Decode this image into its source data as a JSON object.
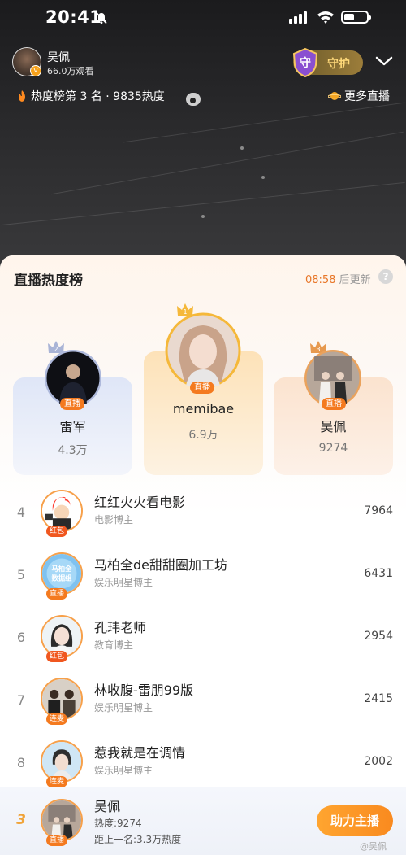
{
  "status_bar": {
    "time": "20:41"
  },
  "host": {
    "name": "吴佩",
    "viewers": "66.0万观看",
    "guard_label": "守护",
    "guard_icon_text": "守"
  },
  "heat": {
    "text": "热度榜第 3 名 · 9835热度",
    "more_live": "更多直播"
  },
  "panel": {
    "title": "直播热度榜",
    "update_time": "08:58",
    "update_suffix": " 后更新",
    "help": "?"
  },
  "top3": [
    {
      "rank": "1",
      "name": "memibae",
      "score": "6.9万",
      "tag": "直播"
    },
    {
      "rank": "2",
      "name": "雷军",
      "score": "4.3万",
      "tag": "直播"
    },
    {
      "rank": "3",
      "name": "吴佩",
      "score": "9274",
      "tag": "直播"
    }
  ],
  "list": [
    {
      "rank": "4",
      "name": "红红火火看电影",
      "sub": "电影博主",
      "score": "7964",
      "tag": "红包"
    },
    {
      "rank": "5",
      "name": "马柏全de甜甜圈加工坊",
      "sub": "娱乐明星博主",
      "score": "6431",
      "tag": "直播"
    },
    {
      "rank": "6",
      "name": "孔玮老师",
      "sub": "教育博主",
      "score": "2954",
      "tag": "红包"
    },
    {
      "rank": "7",
      "name": "林收腹-雷朋99版",
      "sub": "娱乐明星博主",
      "score": "2415",
      "tag": "连麦"
    },
    {
      "rank": "8",
      "name": "惹我就是在调情",
      "sub": "娱乐明星博主",
      "score": "2002",
      "tag": "连麦"
    }
  ],
  "avatar_text": {
    "rank5_line1": "马柏全",
    "rank5_line2": "数据组"
  },
  "me": {
    "rank": "3",
    "name": "吴佩",
    "heat": "热度:9274",
    "gap": "距上一名:3.3万热度",
    "tag": "直播",
    "button": "助力主播"
  },
  "watermark": "@吴佩",
  "colors": {
    "accent": "#f47a1f",
    "gold": "#f5b83a",
    "silver": "#a9b4d6",
    "bronze": "#e79a4f"
  }
}
